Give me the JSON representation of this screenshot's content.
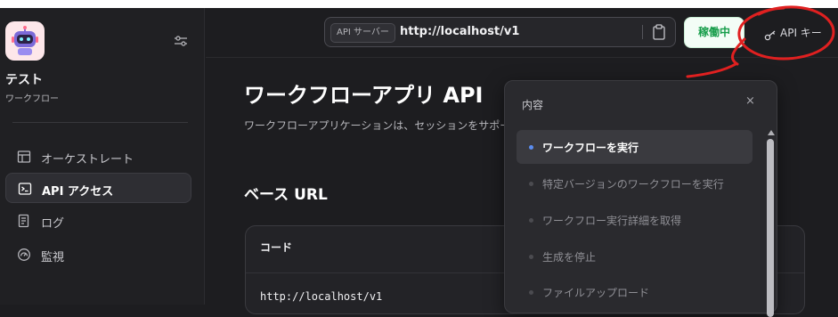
{
  "app": {
    "name": "テスト",
    "type": "ワークフロー"
  },
  "sidebar": {
    "items": [
      {
        "label": "オーケストレート",
        "icon": "orchestrate-icon",
        "active": false
      },
      {
        "label": "API アクセス",
        "icon": "terminal-icon",
        "active": true
      },
      {
        "label": "ログ",
        "icon": "log-icon",
        "active": false
      },
      {
        "label": "監視",
        "icon": "monitor-icon",
        "active": false
      }
    ]
  },
  "header": {
    "api_server_label": "API サーバー",
    "api_server_url": "http://localhost/v1",
    "status_label": "稼働中",
    "api_key_label": "API キー"
  },
  "main": {
    "title": "ワークフローアプリ API",
    "description": "ワークフローアプリケーションは、セッションをサポート",
    "base_url_heading": "ベース URL",
    "code_label": "コード",
    "code_text": "http://localhost/v1"
  },
  "toc": {
    "title": "内容",
    "close": "×",
    "items": [
      {
        "label": "ワークフローを実行",
        "active": true
      },
      {
        "label": "特定バージョンのワークフローを実行",
        "active": false
      },
      {
        "label": "ワークフロー実行詳細を取得",
        "active": false
      },
      {
        "label": "生成を停止",
        "active": false
      },
      {
        "label": "ファイルアップロード",
        "active": false
      }
    ]
  },
  "colors": {
    "status_green": "#169d4a",
    "active_dot": "#5b8def",
    "annotation_red": "#e02020"
  }
}
